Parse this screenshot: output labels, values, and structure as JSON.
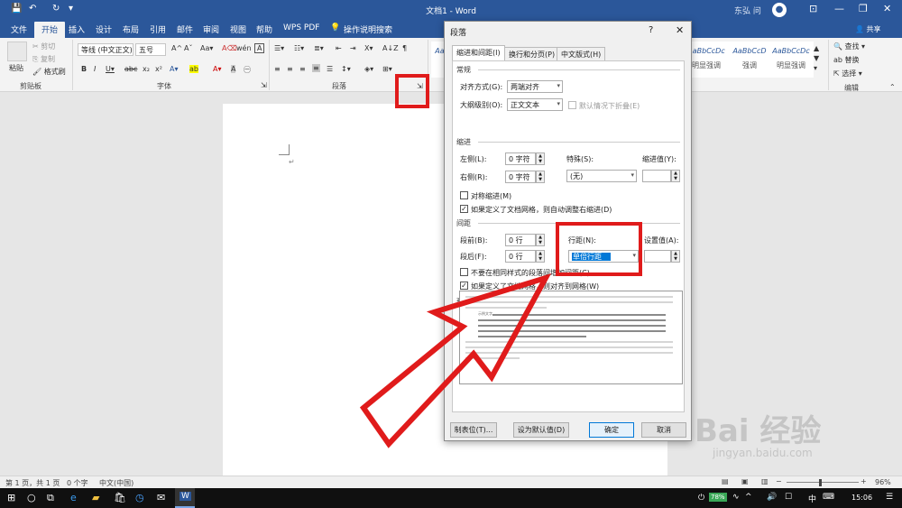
{
  "titlebar": {
    "title": "文档1 - Word",
    "user": "东弘 问",
    "avatar_icon": "user-icon"
  },
  "tabs": [
    "文件",
    "开始",
    "插入",
    "设计",
    "布局",
    "引用",
    "邮件",
    "审阅",
    "视图",
    "帮助",
    "WPS PDF"
  ],
  "active_tab": "开始",
  "tell_me": "操作说明搜索",
  "share": "共享",
  "ribbon": {
    "clipboard": {
      "paste": "粘贴",
      "cut": "剪切",
      "copy": "复制",
      "format_painter": "格式刷",
      "label": "剪贴板"
    },
    "font": {
      "name": "等线 (中文正文)",
      "size": "五号",
      "label": "字体"
    },
    "paragraph": {
      "label": "段落"
    },
    "styles": [
      {
        "sample": "AaBbCcDc",
        "name": ""
      },
      {
        "sample": "AaBbCcDc",
        "name": "明显强调"
      },
      {
        "sample": "AaBbCcD",
        "name": "强调"
      },
      {
        "sample": "AaBbCcDc",
        "name": "明显强调"
      }
    ],
    "editing": {
      "find": "查找",
      "replace": "替换",
      "select": "选择",
      "label": "编辑"
    }
  },
  "dialog": {
    "title": "段落",
    "help": "?",
    "tabs": [
      "缩进和间距(I)",
      "换行和分页(P)",
      "中文版式(H)"
    ],
    "general": {
      "section": "常规",
      "align_label": "对齐方式(G):",
      "align_value": "两端对齐",
      "outline_label": "大纲级别(O):",
      "outline_value": "正文文本",
      "collapse_label": "默认情况下折叠(E)"
    },
    "indent": {
      "section": "缩进",
      "left_label": "左侧(L):",
      "left_value": "0 字符",
      "right_label": "右侧(R):",
      "right_value": "0 字符",
      "special_label": "特殊(S):",
      "special_value": "(无)",
      "indent_by_label": "缩进值(Y):",
      "mirror_label": "对称缩进(M)",
      "auto_adjust_label": "如果定义了文档网格，则自动调整右缩进(D)"
    },
    "spacing": {
      "section": "间距",
      "before_label": "段前(B):",
      "before_value": "0 行",
      "after_label": "段后(F):",
      "after_value": "0 行",
      "line_label": "行距(N):",
      "line_value": "单倍行距",
      "at_label": "设置值(A):",
      "no_space_label": "不要在相同样式的段落间增加间距(C)",
      "snap_label": "如果定义了文档网格，则对齐到网格(W)"
    },
    "preview": {
      "section": "预览",
      "sample_text": "示例文字"
    },
    "buttons": {
      "tabs": "制表位(T)...",
      "default": "设为默认值(D)",
      "ok": "确定",
      "cancel": "取消"
    }
  },
  "statusbar": {
    "page": "第 1 页，共 1 页",
    "words": "0 个字",
    "language": "中文(中国)",
    "zoom": "96%"
  },
  "taskbar": {
    "battery": "78%",
    "ime": "中",
    "time": "15:06"
  },
  "watermark": {
    "brand": "Bai 经验",
    "url": "jingyan.baidu.com"
  },
  "colors": {
    "accent": "#2b579a",
    "highlight": "#e01b1b",
    "selection": "#0078d7"
  }
}
